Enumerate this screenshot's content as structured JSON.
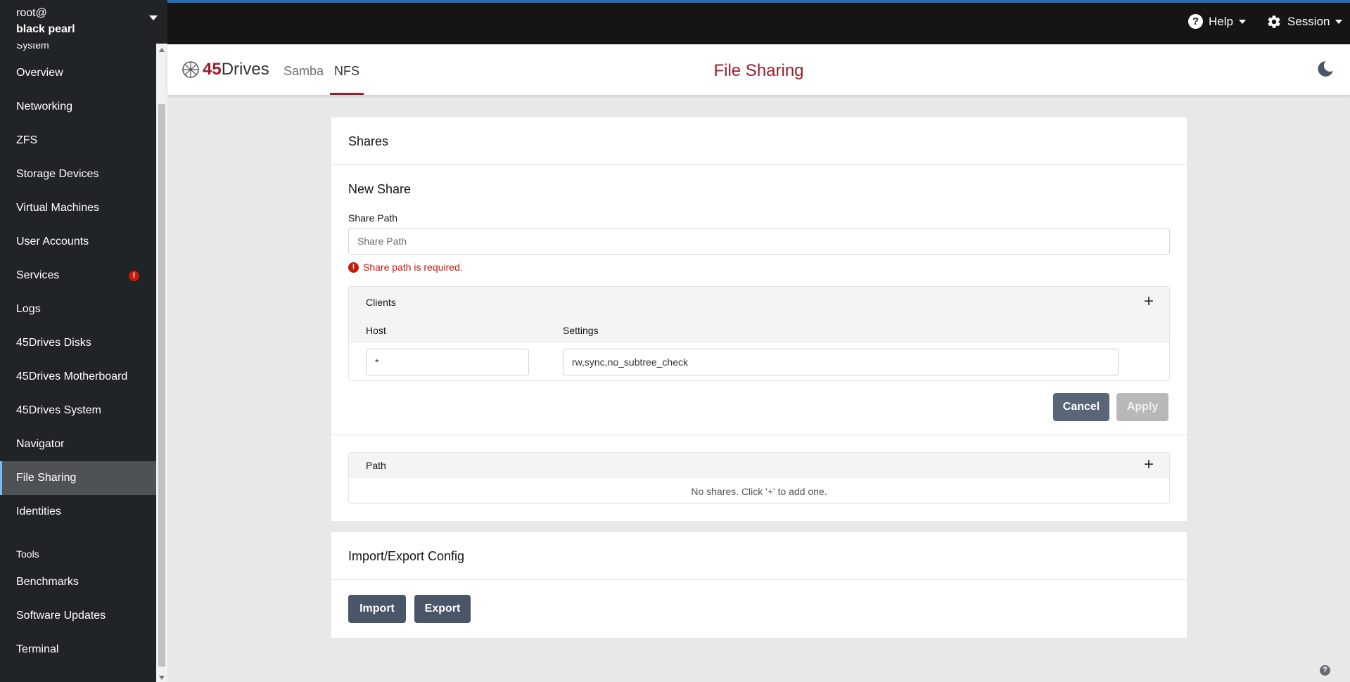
{
  "host": {
    "user": "root@",
    "name": "black pearl"
  },
  "sidebar": {
    "system_label": "System",
    "items": [
      {
        "label": "Overview"
      },
      {
        "label": "Networking"
      },
      {
        "label": "ZFS"
      },
      {
        "label": "Storage Devices"
      },
      {
        "label": "Virtual Machines"
      },
      {
        "label": "User Accounts"
      },
      {
        "label": "Services",
        "badge": "!"
      },
      {
        "label": "Logs"
      },
      {
        "label": "45Drives Disks"
      },
      {
        "label": "45Drives Motherboard"
      },
      {
        "label": "45Drives System"
      },
      {
        "label": "Navigator"
      },
      {
        "label": "File Sharing",
        "active": true
      },
      {
        "label": "Identities"
      }
    ],
    "tools_label": "Tools",
    "tools": [
      {
        "label": "Benchmarks"
      },
      {
        "label": "Software Updates"
      },
      {
        "label": "Terminal"
      }
    ]
  },
  "topbar": {
    "help": "Help",
    "session": "Session"
  },
  "app": {
    "logo_45": "45",
    "logo_drives": "Drives",
    "tabs": [
      {
        "label": "Samba"
      },
      {
        "label": "NFS",
        "active": true
      }
    ],
    "title": "File Sharing"
  },
  "shares": {
    "title": "Shares",
    "new_share": {
      "title": "New Share",
      "path_label": "Share Path",
      "path_placeholder": "Share Path",
      "path_value": "",
      "error": "Share path is required."
    },
    "clients": {
      "title": "Clients",
      "plus": "+",
      "host_header": "Host",
      "settings_header": "Settings",
      "rows": [
        {
          "host": "*",
          "settings": "rw,sync,no_subtree_check"
        }
      ]
    },
    "cancel": "Cancel",
    "apply": "Apply",
    "path_table": {
      "title": "Path",
      "plus": "+",
      "empty": "No shares. Click '+' to add one."
    }
  },
  "import_export": {
    "title": "Import/Export Config",
    "import": "Import",
    "export": "Export"
  },
  "colors": {
    "accent": "#9b1c2c",
    "sidebar_bg": "#212427",
    "topbar_bg": "#151515",
    "button": "#59667a",
    "error": "#c9190b"
  },
  "icons": {
    "help": "help-circle-icon",
    "session": "gear-icon",
    "theme": "moon-icon",
    "error": "exclamation-circle-icon"
  }
}
